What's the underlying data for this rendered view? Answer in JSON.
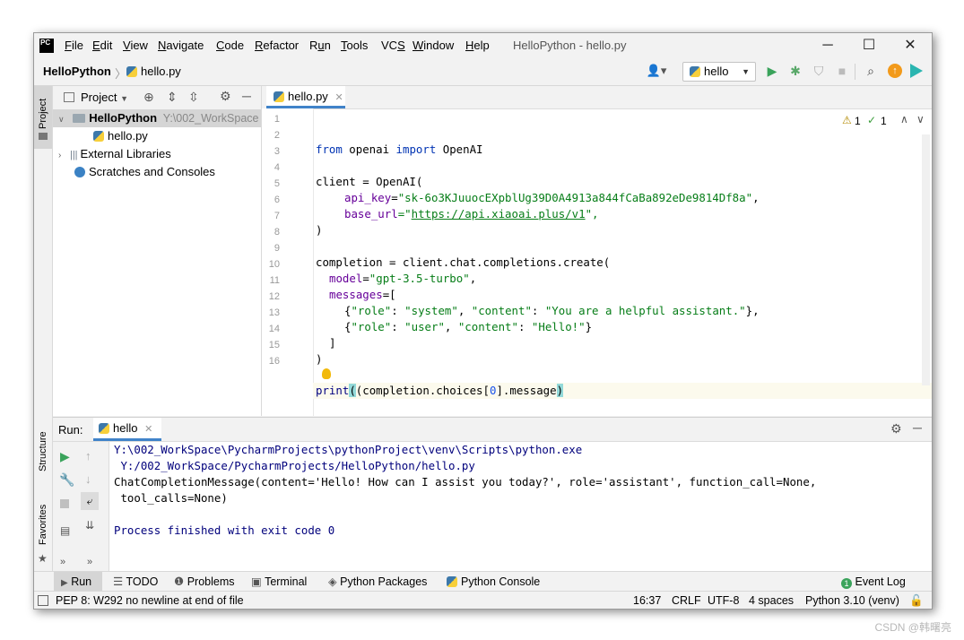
{
  "window": {
    "logo_text": "PC",
    "title": "HelloPython - hello.py",
    "menu": [
      "File",
      "Edit",
      "View",
      "Navigate",
      "Code",
      "Refactor",
      "Run",
      "Tools",
      "VCS",
      "Window",
      "Help"
    ],
    "controls": {
      "minimize": "─",
      "maximize": "☐",
      "close": "✕"
    }
  },
  "navbar": {
    "project": "HelloPython",
    "separator": "〉",
    "file": "hello.py",
    "run_config": "hello",
    "user_icon": "user-icon",
    "icons": [
      "run-icon",
      "debug-icon",
      "coverage-icon",
      "stop-icon",
      "search-icon",
      "update-icon",
      "toolbox-icon"
    ]
  },
  "left_strip": {
    "project": "Project",
    "structure": "Structure",
    "favorites": "Favorites"
  },
  "project_panel": {
    "title": "Project",
    "root_name": "HelloPython",
    "root_path": "Y:\\002_WorkSpace",
    "file": "hello.py",
    "external": "External Libraries",
    "scratches": "Scratches and Consoles"
  },
  "editor": {
    "tab": "hello.py",
    "warnings": "1",
    "typos": "1",
    "line_numbers": [
      "1",
      "2",
      "3",
      "4",
      "5",
      "6",
      "7",
      "8",
      "9",
      "10",
      "11",
      "12",
      "13",
      "14",
      "15",
      "16"
    ],
    "code": {
      "l1_kw1": "from",
      "l1_mod": " openai ",
      "l1_kw2": "import",
      "l1_cls": " OpenAI",
      "l3": "client = OpenAI(",
      "l4_p": "api_key",
      "l4_eq": "=",
      "l4_s": "\"sk-6o3KJuuocEXpblUg39D0A4913a844fCaBa892eDe9814Df8a\"",
      "l4_c": ",",
      "l5_p": "base_url",
      "l5_eq": "=\"",
      "l5_u": "https://api.xiaoai.plus/v1",
      "l5_e": "\",",
      "l6": ")",
      "l8": "completion = client.chat.completions.create(",
      "l9_p": "model",
      "l9_eq": "=",
      "l9_s": "\"gpt-3.5-turbo\"",
      "l9_c": ",",
      "l10_p": "messages",
      "l10_e": "=[",
      "l11_a": "{",
      "l11_s1": "\"role\"",
      "l11_b": ": ",
      "l11_s2": "\"system\"",
      "l11_c": ", ",
      "l11_s3": "\"content\"",
      "l11_d": ": ",
      "l11_s4": "\"You are a helpful assistant.\"",
      "l11_e": "},",
      "l12_a": "{",
      "l12_s1": "\"role\"",
      "l12_b": ": ",
      "l12_s2": "\"user\"",
      "l12_c": ", ",
      "l12_s3": "\"content\"",
      "l12_d": ": ",
      "l12_s4": "\"Hello!\"",
      "l12_e": "}",
      "l13": "]",
      "l14": ")",
      "l16_fn": "print",
      "l16_a": "(completion.choices[",
      "l16_n": "0",
      "l16_b": "].message",
      "l16_c": ")"
    }
  },
  "run": {
    "label": "Run:",
    "tab": "hello",
    "output": [
      "Y:\\002_WorkSpace\\PycharmProjects\\pythonProject\\venv\\Scripts\\python.exe",
      " Y:/002_WorkSpace/PycharmProjects/HelloPython/hello.py",
      "ChatCompletionMessage(content='Hello! How can I assist you today?', role='assistant', function_call=None,",
      " tool_calls=None)",
      "",
      "Process finished with exit code 0"
    ]
  },
  "tool_windows": [
    "Run",
    "TODO",
    "Problems",
    "Terminal",
    "Python Packages",
    "Python Console"
  ],
  "event_log": "Event Log",
  "event_count": "1",
  "status": {
    "message": "PEP 8: W292 no newline at end of file",
    "position": "16:37",
    "line_sep": "CRLF",
    "encoding": "UTF-8",
    "indent": "4 spaces",
    "interpreter": "Python 3.10 (venv)"
  },
  "watermark": "CSDN @韩曙亮"
}
